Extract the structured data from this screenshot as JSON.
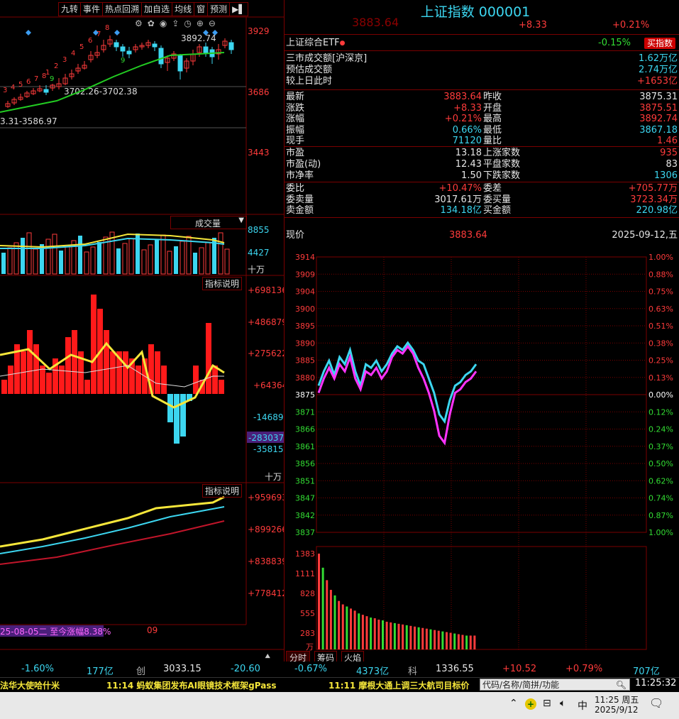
{
  "toolbar": [
    "九转",
    "事件",
    "热点回溯",
    "加自选",
    "均线",
    "窗",
    "预测"
  ],
  "header": {
    "title": "上证指数 000001",
    "price_ghost": "3883.64",
    "change": "+8.33",
    "change_pct": "+0.21%"
  },
  "etf": {
    "name": "上证综合ETF",
    "pct": "-0.15%",
    "buy_label": "买指数"
  },
  "panel1": [
    {
      "label": "三市成交额[沪深京]",
      "value": "1.62万亿",
      "vc": "cyan"
    },
    {
      "label": "预估成交额",
      "value": "2.74万亿",
      "vc": "cyan"
    },
    {
      "label": "较上日此时",
      "value": "+1653亿",
      "vc": "red"
    }
  ],
  "quote_left": [
    {
      "label": "最新",
      "value": "3883.64",
      "vc": "red"
    },
    {
      "label": "涨跌",
      "value": "+8.33",
      "vc": "red"
    },
    {
      "label": "涨幅",
      "value": "+0.21%",
      "vc": "red"
    },
    {
      "label": "振幅",
      "value": "0.66%",
      "vc": "cyan"
    },
    {
      "label": "现手",
      "value": "71120",
      "vc": "cyan"
    }
  ],
  "quote_right": [
    {
      "label": "昨收",
      "value": "3875.31",
      "vc": "white"
    },
    {
      "label": "开盘",
      "value": "3875.51",
      "vc": "red"
    },
    {
      "label": "最高",
      "value": "3892.74",
      "vc": "red"
    },
    {
      "label": "最低",
      "value": "3867.18",
      "vc": "cyan"
    },
    {
      "label": "量比",
      "value": "1.46",
      "vc": "red"
    }
  ],
  "pe_left": [
    {
      "label": "市盈",
      "value": "13.18"
    },
    {
      "label": "市盈(动)",
      "value": "12.43"
    },
    {
      "label": "市净率",
      "value": "1.50"
    }
  ],
  "pe_right": [
    {
      "label": "上涨家数",
      "value": "935",
      "vc": "red"
    },
    {
      "label": "平盘家数",
      "value": "83",
      "vc": "white"
    },
    {
      "label": "下跌家数",
      "value": "1306",
      "vc": "cyan"
    }
  ],
  "order_left": [
    {
      "label": "委比",
      "value": "+10.47%",
      "vc": "red"
    },
    {
      "label": "委卖量",
      "value": "3017.61万",
      "vc": "white"
    },
    {
      "label": "卖金额",
      "value": "134.18亿",
      "vc": "cyan"
    }
  ],
  "order_right": [
    {
      "label": "委差",
      "value": "+705.77万",
      "vc": "red"
    },
    {
      "label": "委买量",
      "value": "3723.34万",
      "vc": "red"
    },
    {
      "label": "买金额",
      "value": "220.98亿",
      "vc": "cyan"
    }
  ],
  "intraday_header": {
    "label": "现价",
    "price": "3883.64",
    "date": "2025-09-12,五"
  },
  "kline": {
    "price_ticks": [
      "3929",
      "3686",
      "3443"
    ],
    "high_label": "3892.74",
    "ma_label1": "3702.26-3702.38",
    "ma_label2": "3.31-3586.97",
    "seq_red": [
      "3",
      "4",
      "5",
      "6",
      "7",
      "8",
      "1",
      "2",
      "3",
      "4",
      "5",
      "6",
      "7",
      "8"
    ],
    "seq_green": [
      "9",
      "9"
    ]
  },
  "volume": {
    "title": "成交量",
    "ticks": [
      "8855",
      "4427"
    ],
    "unit": "十万"
  },
  "indicator1": {
    "title": "指标说明",
    "ticks": [
      "+698136",
      "+486879",
      "+275622",
      "+64364",
      "-146893",
      "-358150"
    ],
    "current": "-283037",
    "unit": "十万"
  },
  "indicator2": {
    "title": "指标说明",
    "ticks": [
      "+959693",
      "+899266",
      "+838839",
      "+778412"
    ]
  },
  "kline_footer": {
    "range": "25-08-05二 至今涨幅8.38%",
    "month": "09"
  },
  "chart_data": {
    "type": "line",
    "title": "",
    "prev_close": 3875.31,
    "ylim": [
      3837,
      3914
    ],
    "y_ticks": [
      "3914",
      "3909",
      "3904",
      "3900",
      "3895",
      "3890",
      "3885",
      "3880",
      "3875",
      "3871",
      "3866",
      "3861",
      "3856",
      "3851",
      "3847",
      "3842",
      "3837"
    ],
    "pct_ticks": [
      "1.00%",
      "0.88%",
      "0.75%",
      "0.63%",
      "0.51%",
      "0.38%",
      "0.25%",
      "0.13%",
      "0.00%",
      "0.12%",
      "0.24%",
      "0.37%",
      "0.50%",
      "0.62%",
      "0.74%",
      "0.87%",
      "1.00%"
    ],
    "vol_ticks": [
      "1383",
      "1111",
      "828",
      "555",
      "283"
    ],
    "vol_unit": "万",
    "series": [
      {
        "color": "#3cd6f0",
        "values": [
          3878,
          3882,
          3885,
          3881,
          3886,
          3884,
          3888,
          3882,
          3878,
          3884,
          3883,
          3885,
          3882,
          3884,
          3887,
          3889,
          3888,
          3890,
          3888,
          3885,
          3884,
          3880,
          3876,
          3870,
          3868,
          3874,
          3878,
          3879,
          3881,
          3882,
          3884
        ]
      },
      {
        "color": "#ff33ff",
        "values": [
          3876,
          3880,
          3883,
          3880,
          3884,
          3882,
          3886,
          3880,
          3877,
          3882,
          3881,
          3883,
          3880,
          3882,
          3886,
          3888,
          3887,
          3889,
          3887,
          3883,
          3880,
          3876,
          3871,
          3864,
          3862,
          3870,
          3876,
          3877,
          3879,
          3880,
          3882
        ]
      }
    ],
    "volumes": [
      1383,
      1180,
      1000,
      860,
      780,
      700,
      650,
      620,
      590,
      560,
      520,
      500,
      480,
      460,
      450,
      430,
      420,
      400,
      390,
      380,
      370,
      360,
      350,
      340,
      330,
      320,
      310,
      300,
      290,
      280,
      270,
      260,
      250,
      240,
      230,
      220,
      210,
      200,
      200,
      200
    ]
  },
  "bottom_tabs": [
    "分时",
    "筹码",
    "火焰"
  ],
  "ticker": [
    {
      "text": "-1.60%",
      "c": "cyan",
      "x": 30
    },
    {
      "text": "177亿",
      "c": "cyan",
      "x": 122
    },
    {
      "text": "创",
      "c": "gray",
      "x": 192
    },
    {
      "text": "3033.15",
      "c": "white",
      "x": 230
    },
    {
      "text": "-20.60",
      "c": "cyan",
      "x": 325
    },
    {
      "text": "-0.67%",
      "c": "cyan",
      "x": 415
    },
    {
      "text": "4373亿",
      "c": "cyan",
      "x": 502
    },
    {
      "text": "科",
      "c": "gray",
      "x": 575
    },
    {
      "text": "1336.55",
      "c": "white",
      "x": 614
    },
    {
      "text": "+10.52",
      "c": "red",
      "x": 708
    },
    {
      "text": "+0.79%",
      "c": "red",
      "x": 797
    },
    {
      "text": "707亿",
      "c": "cyan",
      "x": 892
    }
  ],
  "news": [
    {
      "text": "法华大使哈什米",
      "x": 0
    },
    {
      "text": "11:14 蚂蚁集团发布AI眼镜技术框架gPass",
      "x": 150
    },
    {
      "text": "11:11 摩根大通上调三大航司目标价",
      "x": 463
    }
  ],
  "search": {
    "placeholder": "代码/名称/简拼/功能"
  },
  "clock_top": "11:25:32",
  "taskbar": {
    "ime": "中",
    "time": "11:25 周五",
    "date": "2025/9/12"
  }
}
